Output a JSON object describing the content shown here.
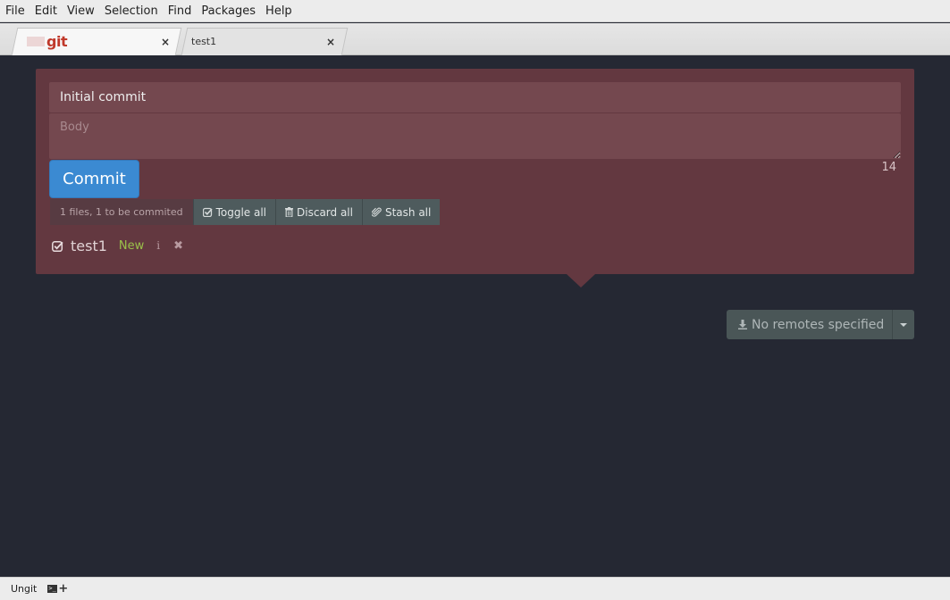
{
  "menubar": {
    "items": [
      {
        "label": "File"
      },
      {
        "label": "Edit"
      },
      {
        "label": "View"
      },
      {
        "label": "Selection"
      },
      {
        "label": "Find"
      },
      {
        "label": "Packages"
      },
      {
        "label": "Help"
      }
    ]
  },
  "tabs": [
    {
      "label": "git",
      "logo": true,
      "close": "×"
    },
    {
      "label": "test1",
      "close": "×"
    }
  ],
  "commit": {
    "title_value": "Initial commit",
    "body_placeholder": "Body",
    "char_count": "14",
    "button_label": "Commit"
  },
  "toolbar": {
    "files_summary": "1 files, 1 to be commited",
    "toggle_all": "Toggle all",
    "discard_all": "Discard all",
    "stash_all": "Stash all"
  },
  "files": [
    {
      "name": "test1",
      "status": "New",
      "info": "i",
      "discard": "✖"
    }
  ],
  "remote": {
    "label": "No remotes specified"
  },
  "statusbar": {
    "label": "Ungit"
  },
  "colors": {
    "panel": "#633840",
    "commit_button": "#3b8ad2",
    "status_new": "#9ac04a",
    "background": "#252833"
  }
}
